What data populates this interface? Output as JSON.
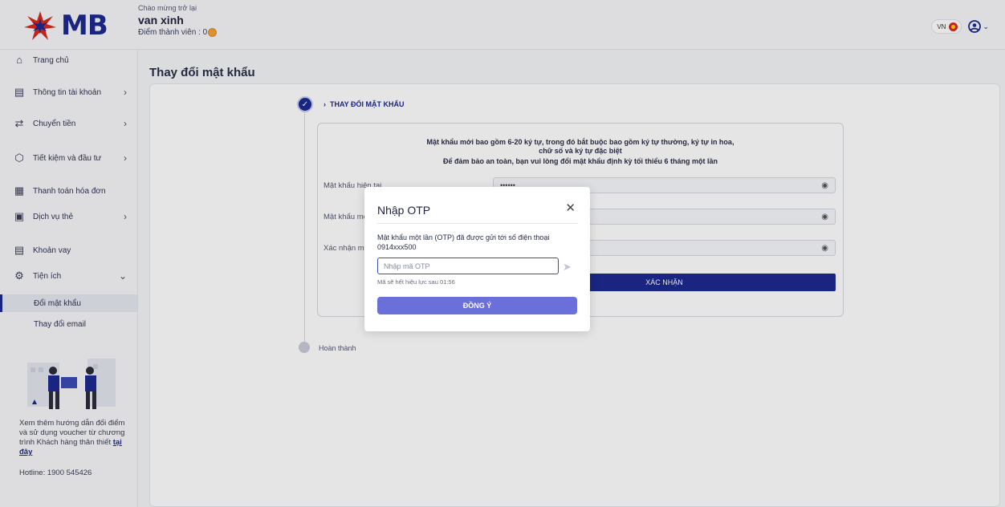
{
  "header": {
    "logo_text": "MB",
    "welcome": "Chào mừng trở lại",
    "username": "van xinh",
    "points_label": "Điểm thành viên : 0",
    "lang": "VN"
  },
  "sidebar": {
    "items": [
      {
        "label": "Trang chủ",
        "icon": "home-icon"
      },
      {
        "label": "Thông tin tài khoản",
        "icon": "account-card-icon"
      },
      {
        "label": "Chuyển tiền",
        "icon": "transfer-icon"
      },
      {
        "label": "Tiết kiệm và đầu tư",
        "icon": "savings-icon"
      },
      {
        "label": "Thanh toán hóa đơn",
        "icon": "bill-icon"
      },
      {
        "label": "Dịch vụ thẻ",
        "icon": "card-icon"
      },
      {
        "label": "Khoản vay",
        "icon": "loan-icon"
      },
      {
        "label": "Tiện ích",
        "icon": "utility-icon"
      }
    ],
    "subitems": [
      {
        "label": "Đổi mật khẩu"
      },
      {
        "label": "Thay đổi email"
      }
    ],
    "promo_text": "Xem thêm hướng dẫn đổi điểm và sử dụng voucher từ chương trình Khách hàng thân thiết",
    "promo_link": "tại đây",
    "hotline": "Hotline: 1900 545426"
  },
  "main": {
    "page_title": "Thay đổi mật khẩu",
    "step_title": "THAY ĐỔI MẬT KHẨU",
    "step_done": "Hoàn thành",
    "notice_1": "Mật khẩu mới bao gồm 6-20 ký tự, trong đó bắt buộc bao gồm ký tự thường, ký tự in hoa,",
    "notice_2": "chữ số và ký tự đặc biệt",
    "notice_3": "Để đảm bảo an toàn, bạn vui lòng đổi mật khẩu định kỳ tối thiểu 6 tháng một lần",
    "field_current": "Mật khẩu hiện tại",
    "field_current_value": "••••••",
    "field_new": "Mật khẩu mới",
    "field_confirm": "Xác nhận mật khẩu mới",
    "submit": "XÁC NHẬN"
  },
  "modal": {
    "title": "Nhập OTP",
    "message": "Mật khẩu một lần (OTP) đã được gửi tới số điện thoại 0914xxx500",
    "placeholder": "Nhập mã OTP",
    "timer": "Mã sẽ hết hiệu lực sau 01:56",
    "ok": "ĐỒNG Ý"
  }
}
